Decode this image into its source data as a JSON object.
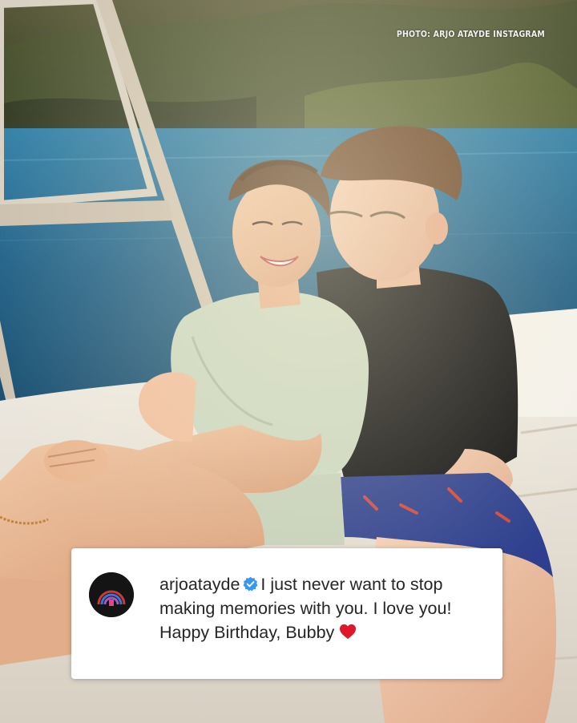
{
  "photo_credit": "PHOTO: ARJO ATAYDE INSTAGRAM",
  "caption": {
    "username": "arjoatayde",
    "text": "I just never want to stop making memories with you. I love you! Happy Birthday, Bubby",
    "verified_icon": "verified-badge-icon",
    "emoji": "red-heart-icon"
  },
  "colors": {
    "water": "#1f5f86",
    "hills": "#3d4a2c",
    "shirt_black": "#121212",
    "blouse_sage": "#c9d6bf",
    "shorts_blue": "#2d3f8e",
    "seat_cream": "#e7e1d6",
    "verified_blue": "#3897f0",
    "heart_red": "#e0172b"
  }
}
